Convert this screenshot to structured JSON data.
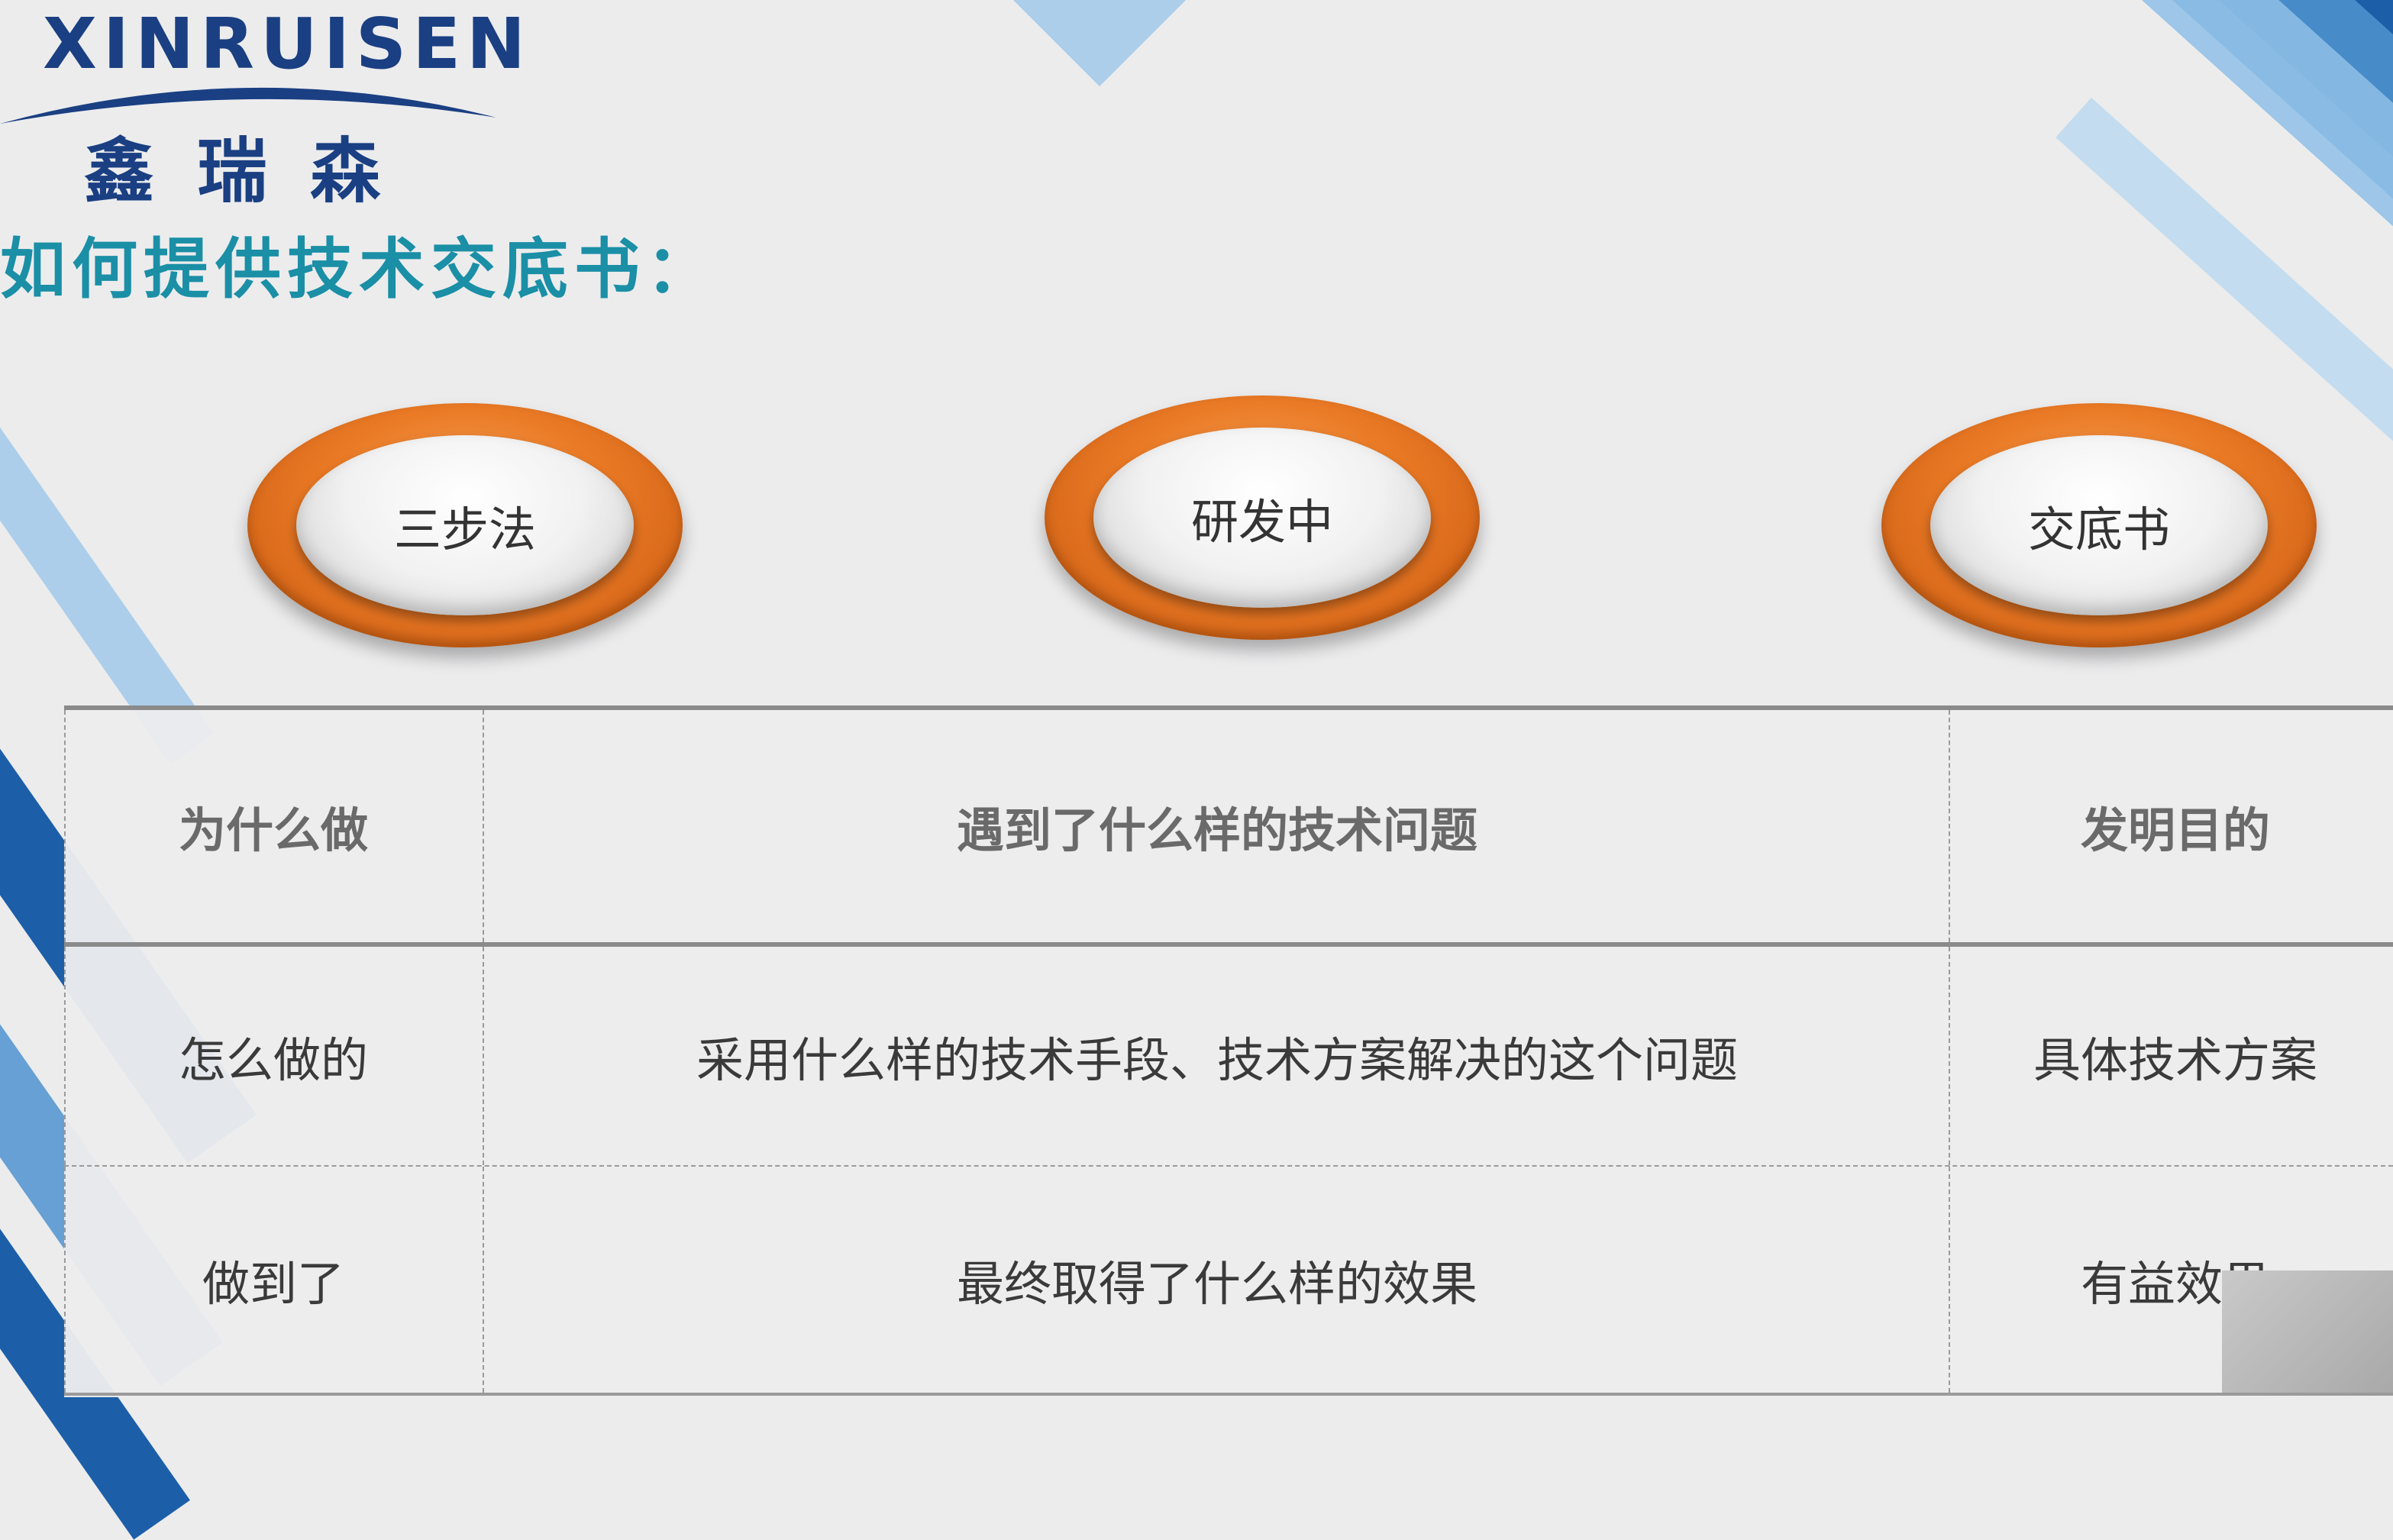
{
  "logo": {
    "brand_latin": "XINRUISEN",
    "brand_cn": "鑫瑞森"
  },
  "heading": "如何提供技术交底书：",
  "pills": [
    {
      "label": "三步法"
    },
    {
      "label": "研发中"
    },
    {
      "label": "交底书"
    }
  ],
  "table": {
    "rows": [
      {
        "col1": "为什么做",
        "col2": "遇到了什么样的技术问题",
        "col3": "发明目的"
      },
      {
        "col1": "怎么做的",
        "col2": "采用什么样的技术手段、技术方案解决的这个问题",
        "col3": "具体技术方案"
      },
      {
        "col1": "做到了",
        "col2": "最终取得了什么样的效果",
        "col3": "有益效果"
      }
    ]
  },
  "colors": {
    "brand_blue": "#1a3f82",
    "heading_teal": "#1a8fa6",
    "pill_orange": "#ea7a25",
    "stripe_blue": "#1c5fa8"
  }
}
